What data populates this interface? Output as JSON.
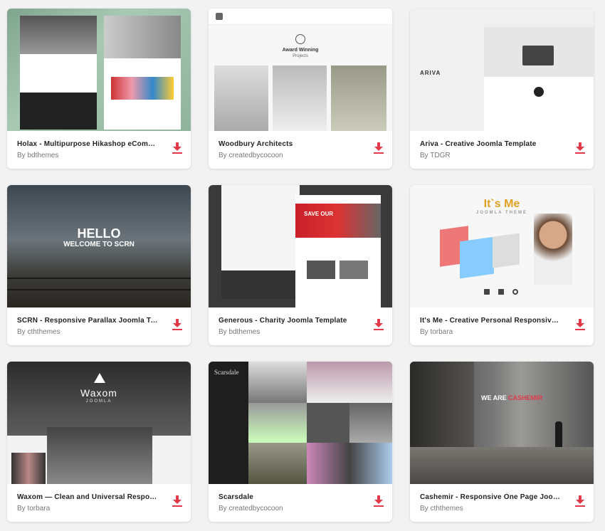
{
  "cards": [
    {
      "title": "Holax - Multipurpose Hikashop eComm…",
      "author": "By bdthemes"
    },
    {
      "title": "Woodbury Architects",
      "author": "By createdbycocoon",
      "thumb_text": "Award Winning",
      "thumb_sub": "Projects"
    },
    {
      "title": "Ariva - Creative Joomla Template",
      "author": "By TDGR",
      "thumb_text": "ARIVA"
    },
    {
      "title": "SCRN - Responsive Parallax Joomla Te…",
      "author": "By cththemes",
      "thumb_text": "HELLO",
      "thumb_sub": "WELCOME TO SCRN"
    },
    {
      "title": "Generous - Charity Joomla Template",
      "author": "By bdthemes",
      "thumb_text": "SAVE OUR"
    },
    {
      "title": "It's Me - Creative Personal Responsive …",
      "author": "By torbara",
      "thumb_text": "It`s Me",
      "thumb_sub": "JOOMLA THEME"
    },
    {
      "title": "Waxom — Clean and Universal Responsi…",
      "author": "By torbara",
      "thumb_text": "Waxom",
      "thumb_sub": "JOOMLA"
    },
    {
      "title": "Scarsdale",
      "author": "By createdbycocoon",
      "thumb_text": "Scarsdale"
    },
    {
      "title": "Cashemir - Responsive One Page Jooml…",
      "author": "By cththemes",
      "thumb_text": "WE ARE",
      "thumb_sub": "CASHEMIR"
    }
  ],
  "colors": {
    "accent": "#e23a4a",
    "title": "#222222",
    "author": "#777777"
  },
  "icons": {
    "download": "download-icon"
  }
}
